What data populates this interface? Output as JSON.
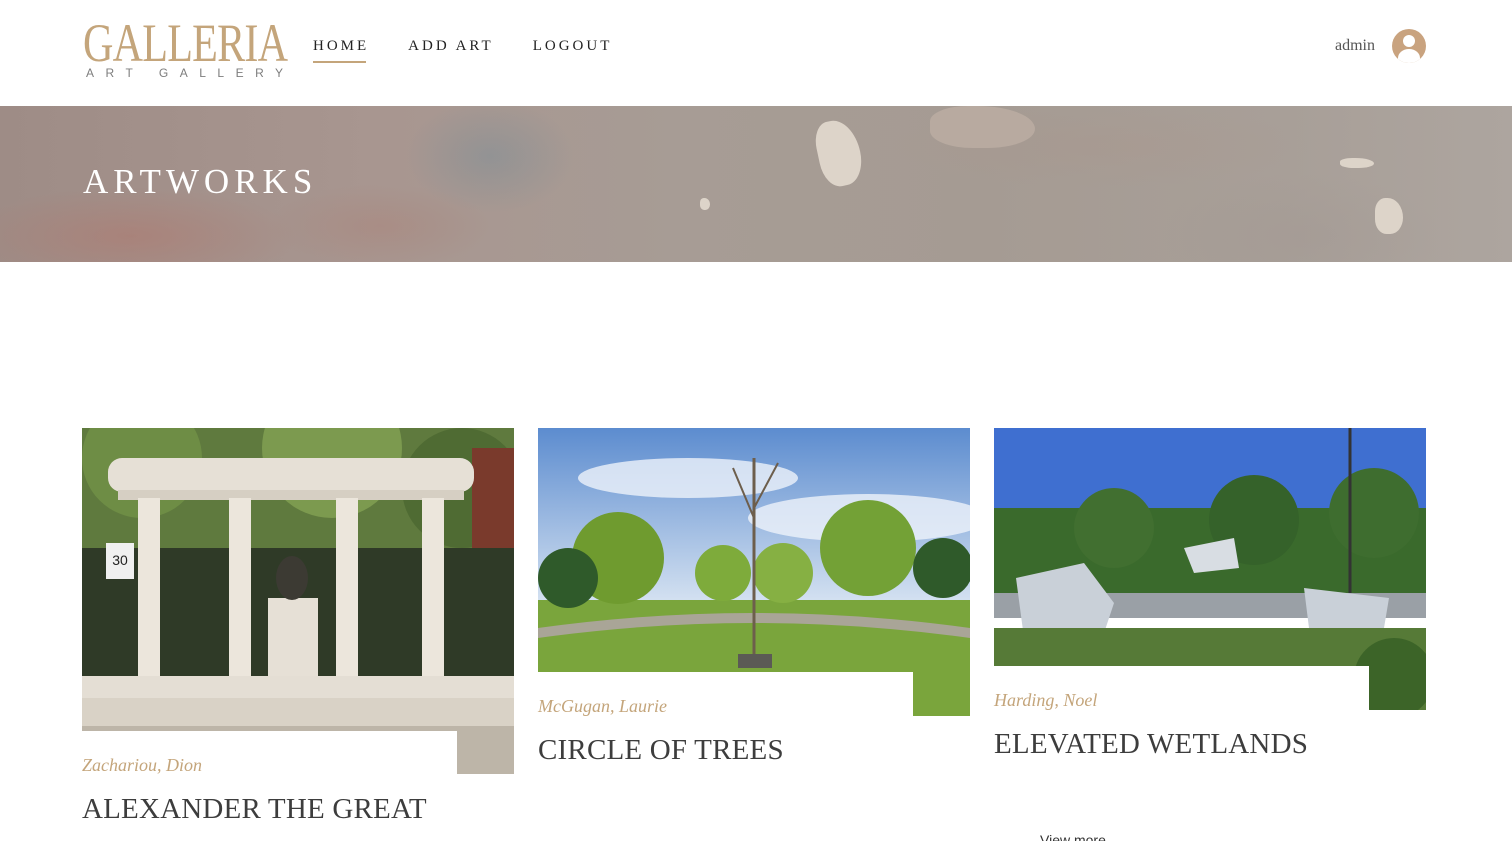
{
  "header": {
    "logo_main": "GALLERIA",
    "logo_sub": "ART GALLERY",
    "nav": [
      {
        "label": "HOME",
        "active": true
      },
      {
        "label": "ADD ART",
        "active": false
      },
      {
        "label": "LOGOUT",
        "active": false
      }
    ],
    "username": "admin",
    "avatar_icon": "user-avatar-icon"
  },
  "banner": {
    "title": "ARTWORKS"
  },
  "artworks": [
    {
      "artist": "Zachariou, Dion",
      "title": "ALEXANDER THE GREAT",
      "image_icon": "monument-colonnade-photo"
    },
    {
      "artist": "McGugan, Laurie",
      "title": "CIRCLE OF TREES",
      "image_icon": "park-trees-photo"
    },
    {
      "artist": "Harding, Noel",
      "title": "ELEVATED WETLANDS",
      "image_icon": "wetlands-sculpture-photo"
    }
  ],
  "view_more_label": "View more",
  "colors": {
    "accent": "#c4a57b",
    "text": "#3d3d3d",
    "banner_title": "#ffffff"
  }
}
